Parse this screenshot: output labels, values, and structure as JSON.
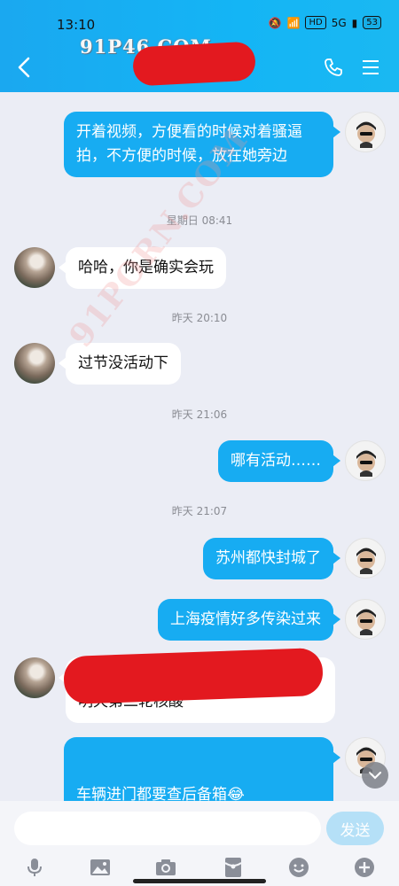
{
  "status_bar": {
    "time": "13:10",
    "hd_badge": "HD",
    "signal": "5G",
    "battery": "53"
  },
  "header": {
    "watermark": "91P46.COM"
  },
  "watermark_diagonal": "91PORN.COM",
  "messages": [
    {
      "side": "me",
      "text": "开着视频，方便看的时候对着骚逼拍，不方便的时候，放在她旁边"
    },
    {
      "type": "time",
      "text": "星期日 08:41"
    },
    {
      "side": "them",
      "text": "哈哈，你是确实会玩"
    },
    {
      "type": "time",
      "text": "昨天 20:10"
    },
    {
      "side": "them",
      "text": "过节没活动下"
    },
    {
      "type": "time",
      "text": "昨天 21:06"
    },
    {
      "side": "me",
      "text": "哪有活动……"
    },
    {
      "type": "time",
      "text": "昨天 21:07"
    },
    {
      "side": "me",
      "text": "苏州都快封城了"
    },
    {
      "side": "me",
      "text": "上海疫情好多传染过来"
    },
    {
      "side": "them",
      "text": "好吧，西安上周也是报了两例本土，明天第二轮核酸"
    },
    {
      "side": "me",
      "text": "车辆进门都要查后备箱😂"
    }
  ],
  "input": {
    "placeholder": "",
    "send_label": "发送"
  },
  "toolbar": [
    "mic-icon",
    "image-icon",
    "camera-icon",
    "red-packet-icon",
    "emoji-icon",
    "plus-icon"
  ]
}
